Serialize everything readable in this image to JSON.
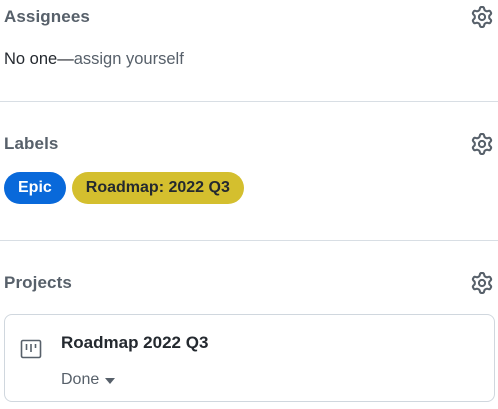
{
  "assignees": {
    "title": "Assignees",
    "empty_prefix": "No one—",
    "assign_link": "assign yourself",
    "settings_icon": "gear-icon"
  },
  "labels": {
    "title": "Labels",
    "settings_icon": "gear-icon",
    "items": [
      {
        "name": "Epic",
        "color": "#0969da",
        "text_color": "#ffffff"
      },
      {
        "name": "Roadmap: 2022 Q3",
        "color": "#d4bf2e",
        "text_color": "#24292f"
      }
    ]
  },
  "projects": {
    "title": "Projects",
    "settings_icon": "gear-icon",
    "items": [
      {
        "name": "Roadmap 2022 Q3",
        "status": "Done",
        "icon": "project-board-icon"
      }
    ]
  }
}
